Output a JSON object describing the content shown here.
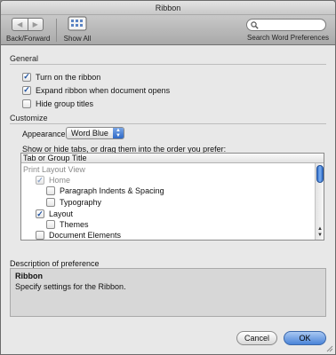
{
  "window": {
    "title": "Ribbon"
  },
  "toolbar": {
    "back_forward_label": "Back/Forward",
    "show_all_label": "Show All",
    "search_label": "Search Word Preferences",
    "search_value": "",
    "back_icon": "chevron-left-icon",
    "forward_icon": "chevron-right-icon",
    "show_all_icon": "grid-icon",
    "search_icon": "magnifier-icon"
  },
  "general": {
    "heading": "General",
    "options": [
      {
        "label": "Turn on the ribbon",
        "checked": true
      },
      {
        "label": "Expand ribbon when document opens",
        "checked": true
      },
      {
        "label": "Hide group titles",
        "checked": false
      }
    ]
  },
  "customize": {
    "heading": "Customize",
    "appearance_label": "Appearance:",
    "appearance_value": "Word Blue",
    "hint": "Show or hide tabs, or drag them into the order you prefer:",
    "list_header": "Tab or Group Title",
    "rows": [
      {
        "label": "Print Layout View",
        "indent": 0,
        "checkbox": false,
        "checked": false,
        "muted": true
      },
      {
        "label": "Home",
        "indent": 1,
        "checkbox": true,
        "checked": true,
        "muted": true
      },
      {
        "label": "Paragraph Indents & Spacing",
        "indent": 2,
        "checkbox": true,
        "checked": false,
        "muted": false
      },
      {
        "label": "Typography",
        "indent": 2,
        "checkbox": true,
        "checked": false,
        "muted": false
      },
      {
        "label": "Layout",
        "indent": 1,
        "checkbox": true,
        "checked": true,
        "muted": false
      },
      {
        "label": "Themes",
        "indent": 2,
        "checkbox": true,
        "checked": false,
        "muted": false
      },
      {
        "label": "Document Elements",
        "indent": 1,
        "checkbox": true,
        "checked": false,
        "muted": false
      }
    ]
  },
  "description": {
    "heading": "Description of preference",
    "title": "Ribbon",
    "text": "Specify settings for the Ribbon."
  },
  "buttons": {
    "cancel": "Cancel",
    "ok": "OK"
  },
  "colors": {
    "accent": "#2f6cc9",
    "checkmark": "#1a4fa0"
  }
}
